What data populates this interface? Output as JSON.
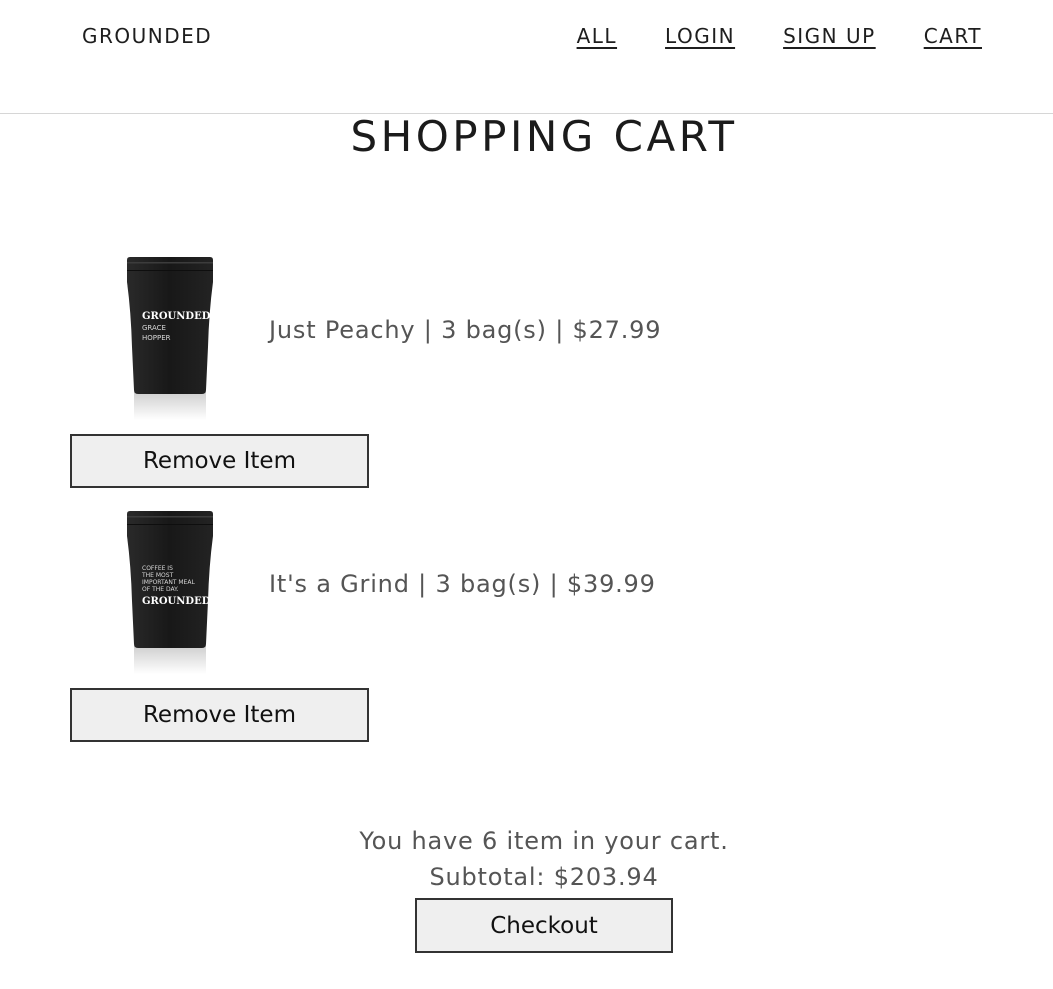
{
  "nav": {
    "brand": "GROUNDED",
    "links": [
      "ALL",
      "LOGIN",
      "SIGN UP",
      "CART"
    ]
  },
  "page": {
    "title": "SHOPPING CART"
  },
  "cart": {
    "items": [
      {
        "description": "Just Peachy | 3 bag(s) | $27.99",
        "image_label_brand": "GROUNDED",
        "image_label_lines": [
          "GRACE",
          "HOPPER"
        ],
        "remove_label": "Remove Item"
      },
      {
        "description": "It's a Grind | 3 bag(s) | $39.99",
        "image_label_brand": "GROUNDED",
        "image_label_lines": [
          "COFFEE IS",
          "THE MOST",
          "IMPORTANT MEAL",
          "OF THE DAY."
        ],
        "remove_label": "Remove Item"
      }
    ],
    "summary_count": "You have 6 item in your cart.",
    "subtotal": "Subtotal: $203.94",
    "checkout_label": "Checkout"
  },
  "colors": {
    "text_primary": "#222222",
    "text_secondary": "#555555",
    "button_bg": "#efefef",
    "bag_color": "#1c1c1c"
  }
}
